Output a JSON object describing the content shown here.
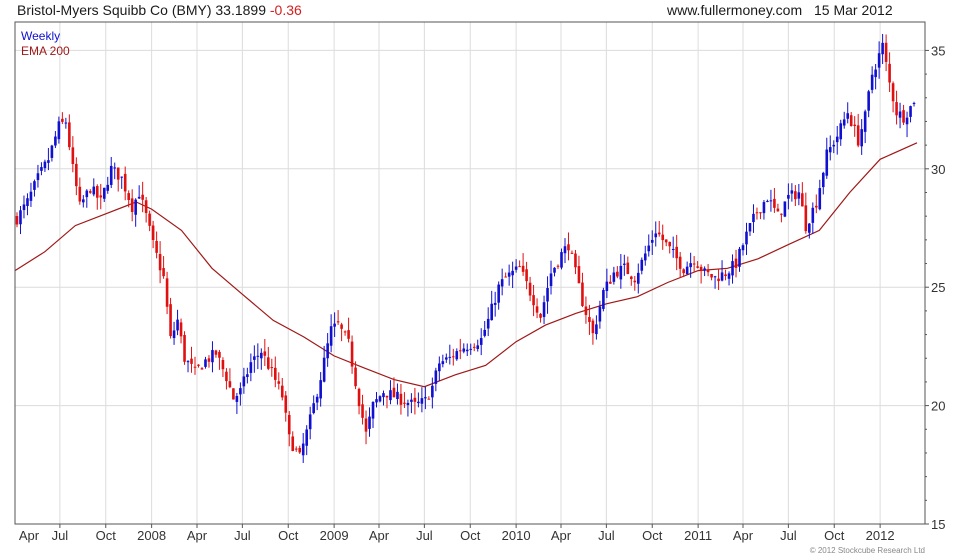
{
  "header": {
    "symbol_line": "Bristol-Myers Squibb Co (BMY) 33.1899",
    "change": "-0.36",
    "site": "www.fullermoney.com",
    "date": "15 Mar 2012"
  },
  "footer": {
    "copyright": "© 2012 Stockcube Research Ltd"
  },
  "colors": {
    "up": "#1010d0",
    "down": "#e01010",
    "ema": "#a01818",
    "grid": "#dcdcdc",
    "frame": "#555555"
  },
  "chart_data": {
    "type": "candlestick",
    "title": "Bristol-Myers Squibb Co (BMY)",
    "legend": [
      "Weekly",
      "EMA 200"
    ],
    "legend_position": "top-left",
    "grid": true,
    "y_axis": {
      "position": "right",
      "ticks": [
        15,
        20,
        25,
        30,
        35
      ],
      "ylim": [
        15,
        36.2
      ]
    },
    "x_axis": {
      "xlim": [
        "2007-04-02",
        "2012-03-31"
      ],
      "ticks": [
        {
          "label": "Apr",
          "date": "2007-04-01"
        },
        {
          "label": "Jul",
          "date": "2007-07-01"
        },
        {
          "label": "Oct",
          "date": "2007-10-01"
        },
        {
          "label": "2008",
          "date": "2008-01-01"
        },
        {
          "label": "Apr",
          "date": "2008-04-01"
        },
        {
          "label": "Jul",
          "date": "2008-07-01"
        },
        {
          "label": "Oct",
          "date": "2008-10-01"
        },
        {
          "label": "2009",
          "date": "2009-01-01"
        },
        {
          "label": "Apr",
          "date": "2009-04-01"
        },
        {
          "label": "Jul",
          "date": "2009-07-01"
        },
        {
          "label": "Oct",
          "date": "2009-10-01"
        },
        {
          "label": "2010",
          "date": "2010-01-01"
        },
        {
          "label": "Apr",
          "date": "2010-04-01"
        },
        {
          "label": "Jul",
          "date": "2010-07-01"
        },
        {
          "label": "Oct",
          "date": "2010-10-01"
        },
        {
          "label": "2011",
          "date": "2011-01-01"
        },
        {
          "label": "Apr",
          "date": "2011-04-01"
        },
        {
          "label": "Jul",
          "date": "2011-07-01"
        },
        {
          "label": "Oct",
          "date": "2011-10-01"
        },
        {
          "label": "2012",
          "date": "2012-01-01"
        }
      ]
    },
    "weekly_close_points": [
      [
        "2007-04-06",
        27.9
      ],
      [
        "2007-04-27",
        28.6
      ],
      [
        "2007-05-18",
        29.6
      ],
      [
        "2007-06-08",
        30.4
      ],
      [
        "2007-06-29",
        31.8
      ],
      [
        "2007-07-13",
        32.0
      ],
      [
        "2007-07-27",
        30.0
      ],
      [
        "2007-08-10",
        28.4
      ],
      [
        "2007-08-31",
        29.2
      ],
      [
        "2007-09-21",
        28.6
      ],
      [
        "2007-10-12",
        30.0
      ],
      [
        "2007-11-02",
        29.6
      ],
      [
        "2007-11-23",
        28.4
      ],
      [
        "2007-12-07",
        29.0
      ],
      [
        "2007-12-21",
        28.0
      ],
      [
        "2008-01-04",
        26.8
      ],
      [
        "2008-01-25",
        25.4
      ],
      [
        "2008-02-08",
        22.8
      ],
      [
        "2008-02-22",
        23.6
      ],
      [
        "2008-03-07",
        22.0
      ],
      [
        "2008-03-28",
        21.4
      ],
      [
        "2008-04-18",
        21.9
      ],
      [
        "2008-05-09",
        22.2
      ],
      [
        "2008-05-30",
        21.2
      ],
      [
        "2008-06-13",
        20.3
      ],
      [
        "2008-06-27",
        20.6
      ],
      [
        "2008-07-18",
        21.8
      ],
      [
        "2008-08-08",
        22.3
      ],
      [
        "2008-08-29",
        21.4
      ],
      [
        "2008-09-19",
        20.4
      ],
      [
        "2008-10-03",
        18.6
      ],
      [
        "2008-10-24",
        17.8
      ],
      [
        "2008-11-14",
        19.4
      ],
      [
        "2008-12-05",
        21.2
      ],
      [
        "2008-12-26",
        23.2
      ],
      [
        "2009-01-09",
        23.4
      ],
      [
        "2009-01-30",
        22.6
      ],
      [
        "2009-02-20",
        20.2
      ],
      [
        "2009-03-06",
        18.8
      ],
      [
        "2009-03-20",
        20.0
      ],
      [
        "2009-04-10",
        20.6
      ],
      [
        "2009-05-01",
        20.4
      ],
      [
        "2009-05-22",
        20.2
      ],
      [
        "2009-06-12",
        20.0
      ],
      [
        "2009-07-03",
        20.2
      ],
      [
        "2009-07-17",
        20.8
      ],
      [
        "2009-07-31",
        21.8
      ],
      [
        "2009-08-21",
        22.0
      ],
      [
        "2009-09-11",
        22.4
      ],
      [
        "2009-10-02",
        22.6
      ],
      [
        "2009-10-23",
        22.8
      ],
      [
        "2009-11-06",
        23.6
      ],
      [
        "2009-11-27",
        25.0
      ],
      [
        "2009-12-11",
        25.4
      ],
      [
        "2010-01-08",
        25.8
      ],
      [
        "2010-01-29",
        24.8
      ],
      [
        "2010-02-19",
        23.8
      ],
      [
        "2010-03-12",
        25.6
      ],
      [
        "2010-04-02",
        26.4
      ],
      [
        "2010-04-16",
        26.8
      ],
      [
        "2010-04-30",
        25.6
      ],
      [
        "2010-05-14",
        24.4
      ],
      [
        "2010-06-04",
        23.0
      ],
      [
        "2010-06-25",
        24.8
      ],
      [
        "2010-07-16",
        25.6
      ],
      [
        "2010-08-06",
        25.8
      ],
      [
        "2010-08-27",
        25.4
      ],
      [
        "2010-09-17",
        26.4
      ],
      [
        "2010-10-08",
        27.4
      ],
      [
        "2010-10-22",
        27.0
      ],
      [
        "2010-11-12",
        26.4
      ],
      [
        "2010-12-03",
        25.8
      ],
      [
        "2010-12-24",
        26.2
      ],
      [
        "2011-01-14",
        25.6
      ],
      [
        "2011-02-04",
        25.4
      ],
      [
        "2011-02-25",
        25.6
      ],
      [
        "2011-03-18",
        26.0
      ],
      [
        "2011-04-08",
        27.2
      ],
      [
        "2011-04-29",
        28.2
      ],
      [
        "2011-05-20",
        28.8
      ],
      [
        "2011-06-10",
        28.0
      ],
      [
        "2011-07-01",
        28.8
      ],
      [
        "2011-07-22",
        29.0
      ],
      [
        "2011-08-05",
        27.6
      ],
      [
        "2011-08-26",
        28.6
      ],
      [
        "2011-09-16",
        30.6
      ],
      [
        "2011-10-07",
        31.4
      ],
      [
        "2011-10-28",
        32.4
      ],
      [
        "2011-11-18",
        31.2
      ],
      [
        "2011-12-02",
        32.2
      ],
      [
        "2011-12-16",
        34.0
      ],
      [
        "2012-01-06",
        35.2
      ],
      [
        "2012-01-20",
        33.6
      ],
      [
        "2012-02-03",
        32.4
      ],
      [
        "2012-02-17",
        32.2
      ],
      [
        "2012-03-02",
        32.6
      ],
      [
        "2012-03-15",
        33.2
      ]
    ],
    "ema200_points": [
      [
        "2007-04-02",
        25.7
      ],
      [
        "2007-06-01",
        26.5
      ],
      [
        "2007-08-01",
        27.6
      ],
      [
        "2007-10-01",
        28.1
      ],
      [
        "2007-12-01",
        28.6
      ],
      [
        "2008-01-01",
        28.3
      ],
      [
        "2008-03-01",
        27.4
      ],
      [
        "2008-05-01",
        25.8
      ],
      [
        "2008-07-01",
        24.7
      ],
      [
        "2008-09-01",
        23.6
      ],
      [
        "2008-11-01",
        22.9
      ],
      [
        "2009-01-01",
        22.1
      ],
      [
        "2009-03-01",
        21.6
      ],
      [
        "2009-05-01",
        21.1
      ],
      [
        "2009-07-01",
        20.8
      ],
      [
        "2009-09-01",
        21.3
      ],
      [
        "2009-11-01",
        21.7
      ],
      [
        "2010-01-01",
        22.7
      ],
      [
        "2010-03-01",
        23.4
      ],
      [
        "2010-05-01",
        23.9
      ],
      [
        "2010-07-01",
        24.3
      ],
      [
        "2010-09-01",
        24.6
      ],
      [
        "2010-11-01",
        25.2
      ],
      [
        "2011-01-01",
        25.7
      ],
      [
        "2011-03-01",
        25.8
      ],
      [
        "2011-05-01",
        26.2
      ],
      [
        "2011-07-01",
        26.8
      ],
      [
        "2011-09-01",
        27.4
      ],
      [
        "2011-11-01",
        29.0
      ],
      [
        "2012-01-01",
        30.4
      ],
      [
        "2012-03-15",
        31.1
      ]
    ]
  }
}
